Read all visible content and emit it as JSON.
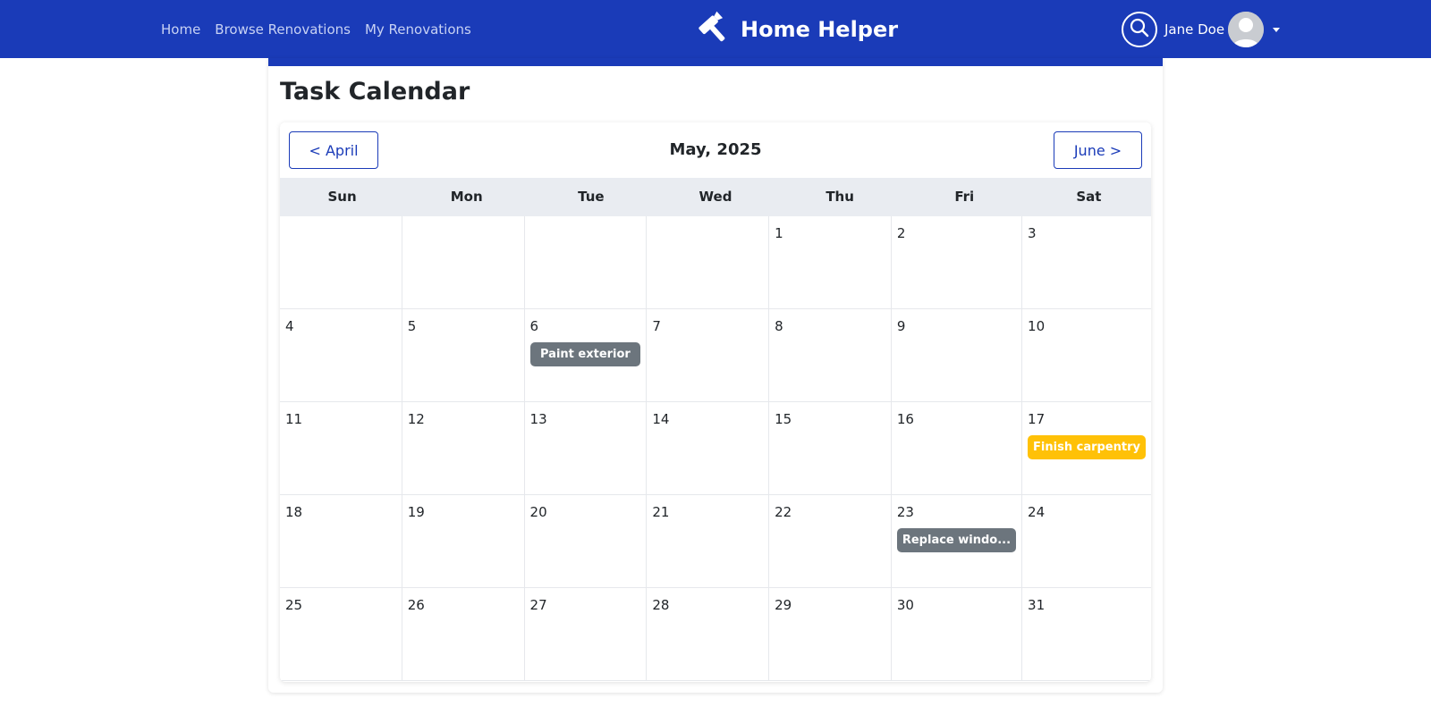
{
  "nav": {
    "links": [
      "Home",
      "Browse Renovations",
      "My Renovations"
    ],
    "brand": "Home Helper",
    "user_name": "Jane Doe"
  },
  "page": {
    "title": "Task Calendar"
  },
  "calendar": {
    "prev_label": "< April",
    "next_label": "June >",
    "month_title": "May, 2025",
    "weekdays": [
      "Sun",
      "Mon",
      "Tue",
      "Wed",
      "Thu",
      "Fri",
      "Sat"
    ],
    "weeks": [
      [
        {
          "day": ""
        },
        {
          "day": ""
        },
        {
          "day": ""
        },
        {
          "day": ""
        },
        {
          "day": "1"
        },
        {
          "day": "2"
        },
        {
          "day": "3"
        }
      ],
      [
        {
          "day": "4"
        },
        {
          "day": "5"
        },
        {
          "day": "6",
          "event": {
            "label": "Paint exterior",
            "color": "#6c757d"
          }
        },
        {
          "day": "7"
        },
        {
          "day": "8"
        },
        {
          "day": "9"
        },
        {
          "day": "10"
        }
      ],
      [
        {
          "day": "11"
        },
        {
          "day": "12"
        },
        {
          "day": "13"
        },
        {
          "day": "14"
        },
        {
          "day": "15"
        },
        {
          "day": "16"
        },
        {
          "day": "17",
          "event": {
            "label": "Finish carpentry",
            "color": "#ffc107"
          }
        }
      ],
      [
        {
          "day": "18"
        },
        {
          "day": "19"
        },
        {
          "day": "20"
        },
        {
          "day": "21"
        },
        {
          "day": "22"
        },
        {
          "day": "23",
          "event": {
            "label": "Replace windo...",
            "color": "#6c757d"
          }
        },
        {
          "day": "24"
        }
      ],
      [
        {
          "day": "25"
        },
        {
          "day": "26"
        },
        {
          "day": "27"
        },
        {
          "day": "28"
        },
        {
          "day": "29"
        },
        {
          "day": "30"
        },
        {
          "day": "31"
        }
      ]
    ]
  },
  "colors": {
    "navbar": "#1a3bb8",
    "event_gray": "#6c757d",
    "event_yellow": "#ffc107",
    "weekday_header_bg": "#e9ecf1"
  },
  "icons": {
    "brand": "hammer-icon",
    "search": "search-icon",
    "avatar": "user-avatar-icon",
    "menu": "caret-down-icon"
  }
}
